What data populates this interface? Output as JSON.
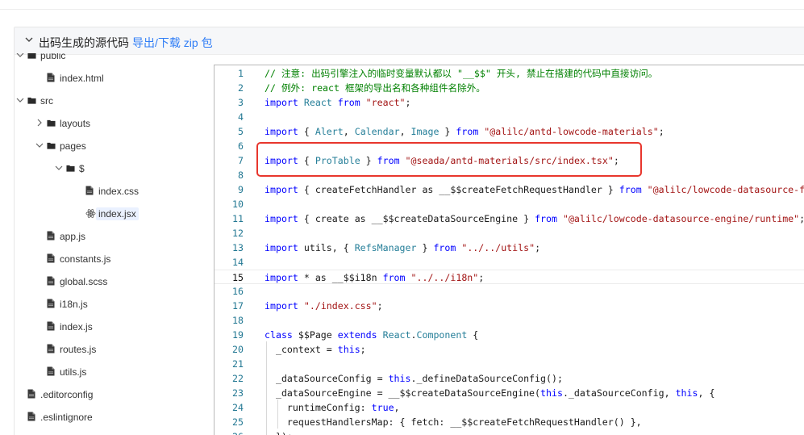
{
  "panel": {
    "title": "出码生成的源代码",
    "download_link": "导出/下载 zip 包",
    "caret_icon": "chevron-down-icon"
  },
  "tree": [
    {
      "label": "public",
      "type": "folder",
      "indent": 0,
      "expanded": true,
      "partial": true
    },
    {
      "label": "index.html",
      "type": "file",
      "indent": 1
    },
    {
      "label": "src",
      "type": "folder",
      "indent": 0,
      "expanded": true
    },
    {
      "label": "layouts",
      "type": "folder",
      "indent": 1,
      "expanded": false
    },
    {
      "label": "pages",
      "type": "folder",
      "indent": 1,
      "expanded": true
    },
    {
      "label": "$",
      "type": "folder",
      "indent": 2,
      "expanded": true
    },
    {
      "label": "index.css",
      "type": "file",
      "indent": 3
    },
    {
      "label": "index.jsx",
      "type": "react",
      "indent": 3,
      "selected": true
    },
    {
      "label": "app.js",
      "type": "file",
      "indent": 1
    },
    {
      "label": "constants.js",
      "type": "file",
      "indent": 1
    },
    {
      "label": "global.scss",
      "type": "file",
      "indent": 1
    },
    {
      "label": "i18n.js",
      "type": "file",
      "indent": 1
    },
    {
      "label": "index.js",
      "type": "file",
      "indent": 1
    },
    {
      "label": "routes.js",
      "type": "file",
      "indent": 1
    },
    {
      "label": "utils.js",
      "type": "file",
      "indent": 1
    },
    {
      "label": ".editorconfig",
      "type": "file",
      "indent": 0
    },
    {
      "label": ".eslintignore",
      "type": "file",
      "indent": 0
    }
  ],
  "code": {
    "current_line": 15,
    "lines": [
      [
        [
          "cm",
          "// 注意: 出码引擎注入的临时变量默认都以 \"__$$\" 开头, 禁止在搭建的代码中直接访问。"
        ]
      ],
      [
        [
          "cm",
          "// 例外: react 框架的导出名和各种组件名除外。"
        ]
      ],
      [
        [
          "kw",
          "import"
        ],
        [
          "t",
          " "
        ],
        [
          "ty",
          "React"
        ],
        [
          "t",
          " "
        ],
        [
          "kw",
          "from"
        ],
        [
          "t",
          " "
        ],
        [
          "str",
          "\"react\""
        ],
        [
          "t",
          ";"
        ]
      ],
      [],
      [
        [
          "kw",
          "import"
        ],
        [
          "t",
          " { "
        ],
        [
          "ty",
          "Alert"
        ],
        [
          "t",
          ", "
        ],
        [
          "ty",
          "Calendar"
        ],
        [
          "t",
          ", "
        ],
        [
          "ty",
          "Image"
        ],
        [
          "t",
          " } "
        ],
        [
          "kw",
          "from"
        ],
        [
          "t",
          " "
        ],
        [
          "str",
          "\"@alilc/antd-lowcode-materials\""
        ],
        [
          "t",
          ";"
        ]
      ],
      [],
      [
        [
          "kw",
          "import"
        ],
        [
          "t",
          " { "
        ],
        [
          "ty",
          "ProTable"
        ],
        [
          "t",
          " } "
        ],
        [
          "kw",
          "from"
        ],
        [
          "t",
          " "
        ],
        [
          "str",
          "\"@seada/antd-materials/src/index.tsx\""
        ],
        [
          "t",
          ";"
        ]
      ],
      [],
      [
        [
          "kw",
          "import"
        ],
        [
          "t",
          " { createFetchHandler as __$$createFetchRequestHandler } "
        ],
        [
          "kw",
          "from"
        ],
        [
          "t",
          " "
        ],
        [
          "str",
          "\"@alilc/lowcode-datasource-fetch-handler\""
        ],
        [
          "t",
          ";"
        ]
      ],
      [],
      [
        [
          "kw",
          "import"
        ],
        [
          "t",
          " { create as __$$createDataSourceEngine } "
        ],
        [
          "kw",
          "from"
        ],
        [
          "t",
          " "
        ],
        [
          "str",
          "\"@alilc/lowcode-datasource-engine/runtime\""
        ],
        [
          "t",
          ";"
        ]
      ],
      [],
      [
        [
          "kw",
          "import"
        ],
        [
          "t",
          " utils, { "
        ],
        [
          "ty",
          "RefsManager"
        ],
        [
          "t",
          " } "
        ],
        [
          "kw",
          "from"
        ],
        [
          "t",
          " "
        ],
        [
          "str",
          "\"../../utils\""
        ],
        [
          "t",
          ";"
        ]
      ],
      [],
      [
        [
          "kw",
          "import"
        ],
        [
          "t",
          " * as __$$i18n "
        ],
        [
          "kw",
          "from"
        ],
        [
          "t",
          " "
        ],
        [
          "str",
          "\"../../i18n\""
        ],
        [
          "t",
          ";"
        ]
      ],
      [],
      [
        [
          "kw",
          "import"
        ],
        [
          "t",
          " "
        ],
        [
          "str",
          "\"./index.css\""
        ],
        [
          "t",
          ";"
        ]
      ],
      [],
      [
        [
          "kw",
          "class"
        ],
        [
          "t",
          " $$Page "
        ],
        [
          "kw",
          "extends"
        ],
        [
          "t",
          " "
        ],
        [
          "ty",
          "React"
        ],
        [
          "t",
          "."
        ],
        [
          "ty",
          "Component"
        ],
        [
          "t",
          " {"
        ]
      ],
      [
        [
          "t",
          "  _context = "
        ],
        [
          "kw",
          "this"
        ],
        [
          "t",
          ";"
        ]
      ],
      [],
      [
        [
          "t",
          "  _dataSourceConfig = "
        ],
        [
          "kw",
          "this"
        ],
        [
          "t",
          "._defineDataSourceConfig();"
        ]
      ],
      [
        [
          "t",
          "  _dataSourceEngine = __$$createDataSourceEngine("
        ],
        [
          "kw",
          "this"
        ],
        [
          "t",
          "._dataSourceConfig, "
        ],
        [
          "kw",
          "this"
        ],
        [
          "t",
          ", {"
        ]
      ],
      [
        [
          "t",
          "    runtimeConfig: "
        ],
        [
          "kw",
          "true"
        ],
        [
          "t",
          ","
        ]
      ],
      [
        [
          "t",
          "    requestHandlersMap: { fetch: __$$createFetchRequestHandler() },"
        ]
      ],
      [
        [
          "t",
          "  });"
        ]
      ]
    ]
  }
}
